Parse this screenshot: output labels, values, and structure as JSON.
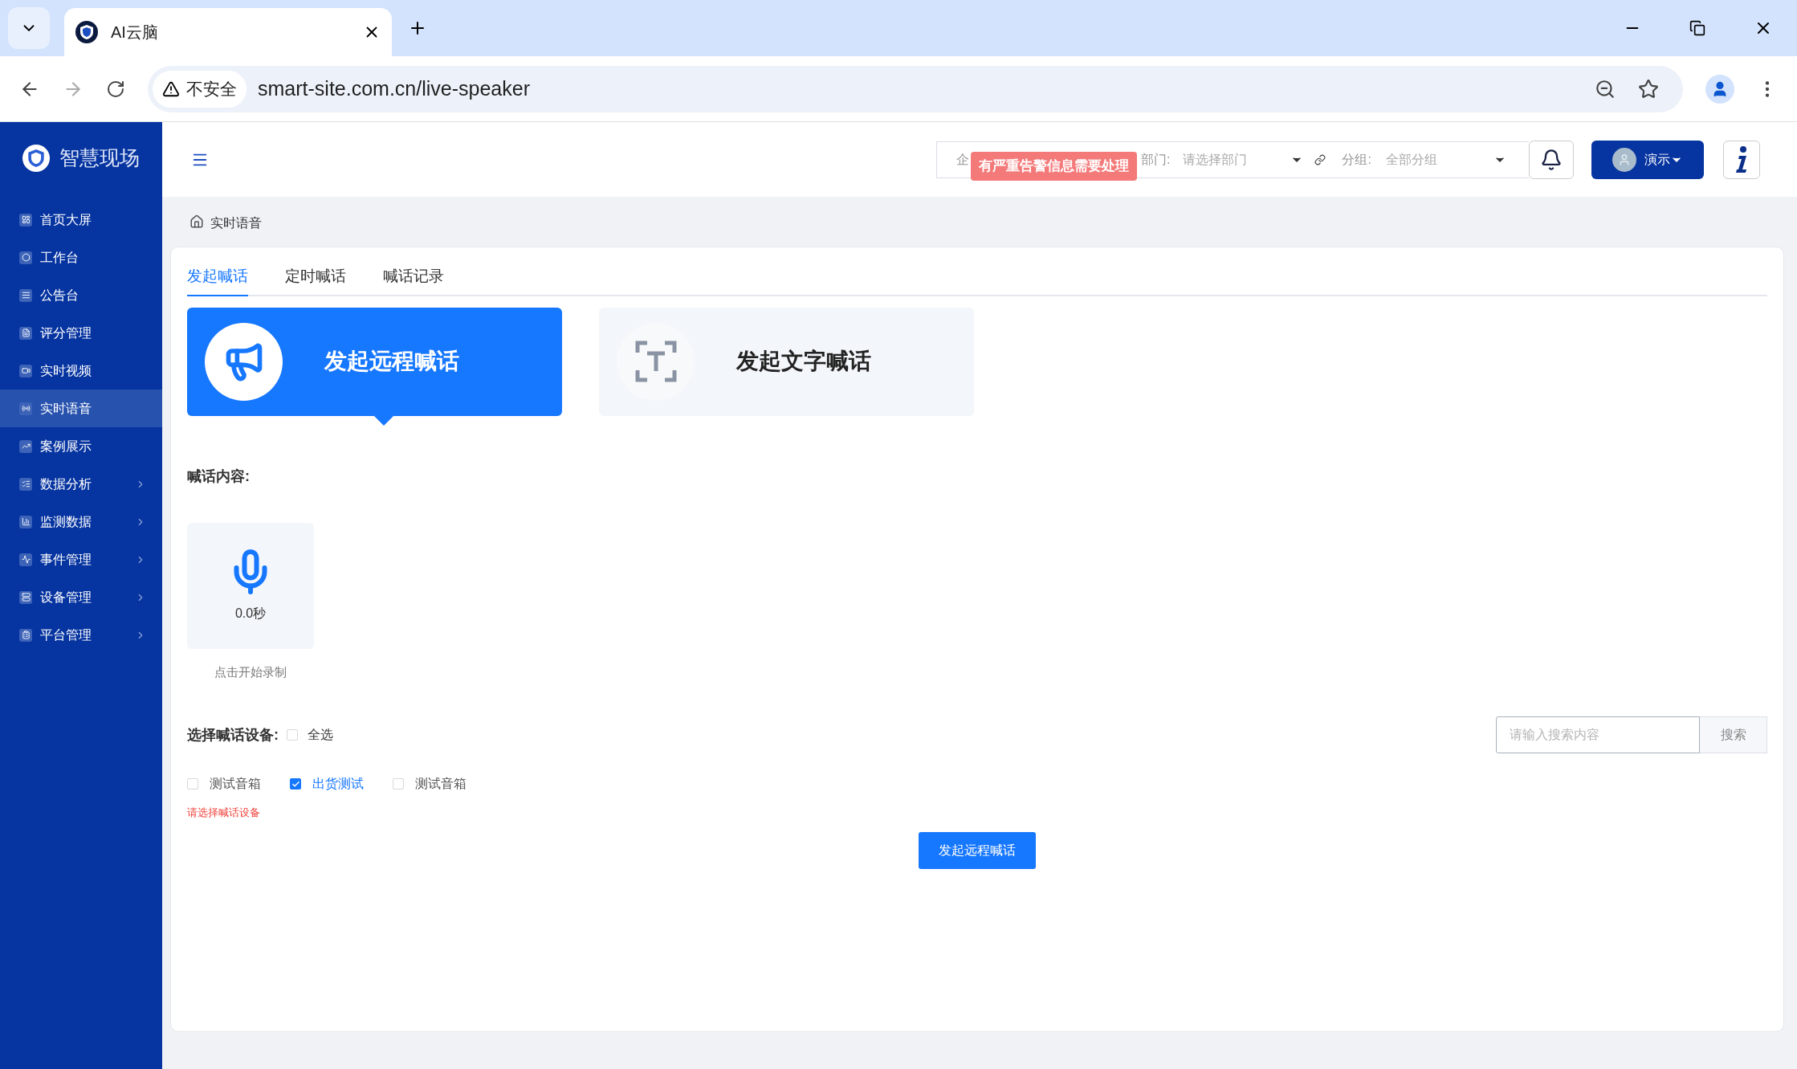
{
  "browser": {
    "tab_title": "AI云脑",
    "security_label": "不安全",
    "url": "smart-site.com.cn/live-speaker"
  },
  "sidebar": {
    "logo_text": "智慧现场",
    "items": [
      {
        "label": "首页大屏",
        "selected": false,
        "expandable": false
      },
      {
        "label": "工作台",
        "selected": false,
        "expandable": false
      },
      {
        "label": "公告台",
        "selected": false,
        "expandable": false
      },
      {
        "label": "评分管理",
        "selected": false,
        "expandable": false
      },
      {
        "label": "实时视频",
        "selected": false,
        "expandable": false
      },
      {
        "label": "实时语音",
        "selected": true,
        "expandable": false
      },
      {
        "label": "案例展示",
        "selected": false,
        "expandable": false
      },
      {
        "label": "数据分析",
        "selected": false,
        "expandable": true
      },
      {
        "label": "监测数据",
        "selected": false,
        "expandable": true
      },
      {
        "label": "事件管理",
        "selected": false,
        "expandable": true
      },
      {
        "label": "设备管理",
        "selected": false,
        "expandable": true
      },
      {
        "label": "平台管理",
        "selected": false,
        "expandable": true
      }
    ]
  },
  "header": {
    "company_label": "企",
    "alert": "有严重告警信息需要处理",
    "department": {
      "label": "部门:",
      "placeholder": "请选择部门"
    },
    "group": {
      "label": "分组:",
      "value": "全部分组"
    },
    "user": "演示"
  },
  "breadcrumb": "实时语音",
  "tabs": [
    {
      "label": "发起喊话",
      "selected": true
    },
    {
      "label": "定时喊话",
      "selected": false
    },
    {
      "label": "喊话记录",
      "selected": false
    }
  ],
  "modes": [
    {
      "kind": "megaphone",
      "title": "发起远程喊话",
      "selected": true
    },
    {
      "kind": "text",
      "title": "发起文字喊话",
      "selected": false
    }
  ],
  "content_label": "喊话内容:",
  "recorder": {
    "duration": "0.0秒",
    "hint": "点击开始录制"
  },
  "devices": {
    "label": "选择喊话设备:",
    "select_all": {
      "label": "全选",
      "checked": false
    },
    "search": {
      "placeholder": "请输入搜索内容",
      "button": "搜索"
    },
    "items": [
      {
        "label": "测试音箱",
        "checked": false
      },
      {
        "label": "出货测试",
        "checked": true
      },
      {
        "label": "测试音箱",
        "checked": false
      }
    ],
    "error": "请选择喊话设备"
  },
  "submit": "发起远程喊话"
}
